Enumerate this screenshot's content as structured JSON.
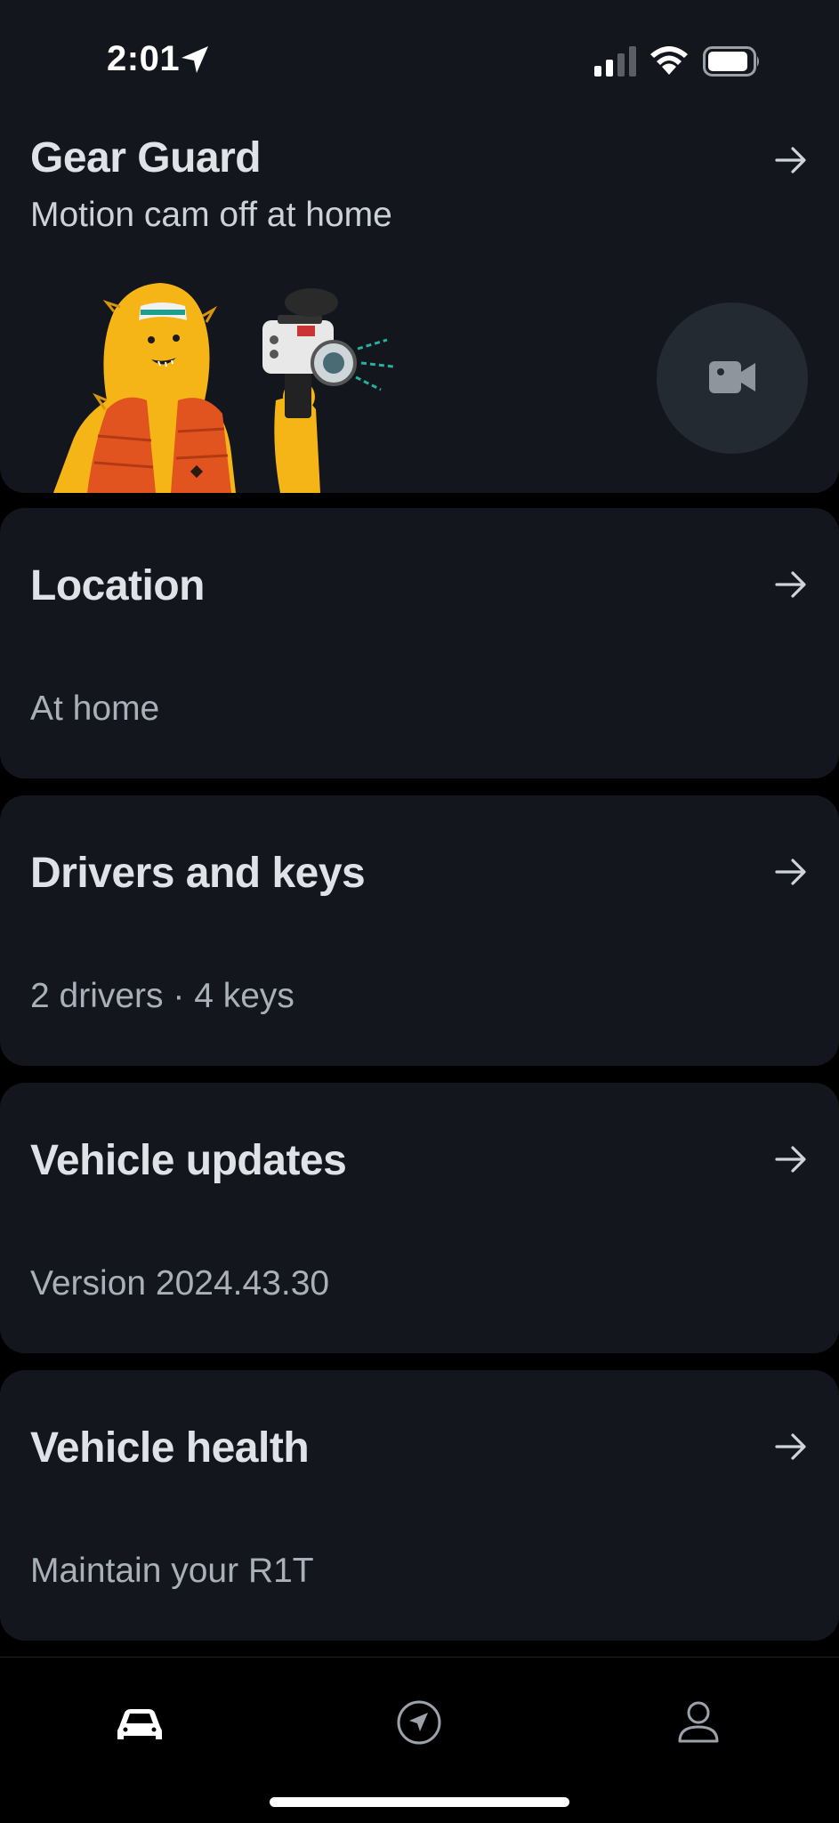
{
  "status_bar": {
    "time": "2:01",
    "icons": [
      "location-arrow-icon",
      "signal-icon",
      "wifi-icon",
      "battery-icon"
    ]
  },
  "gear_guard": {
    "title": "Gear Guard",
    "subtitle": "Motion cam off at home",
    "camera_button_icon": "video-camera-icon"
  },
  "cards": {
    "location": {
      "title": "Location",
      "subtitle": "At home"
    },
    "drivers": {
      "title": "Drivers and keys",
      "subtitle": "2 drivers · 4 keys"
    },
    "updates": {
      "title": "Vehicle updates",
      "subtitle": "Version 2024.43.30"
    },
    "health": {
      "title": "Vehicle health",
      "subtitle": "Maintain your R1T"
    }
  },
  "nav": {
    "items": [
      "vehicle-icon",
      "navigation-icon",
      "profile-icon"
    ],
    "active": "vehicle-icon"
  },
  "colors": {
    "background": "#000000",
    "card": "#13171d",
    "title": "#dfe3e8",
    "subtitle": "#a9b0b8",
    "mascot_yellow": "#f5b517",
    "vest_orange": "#e2541f"
  }
}
